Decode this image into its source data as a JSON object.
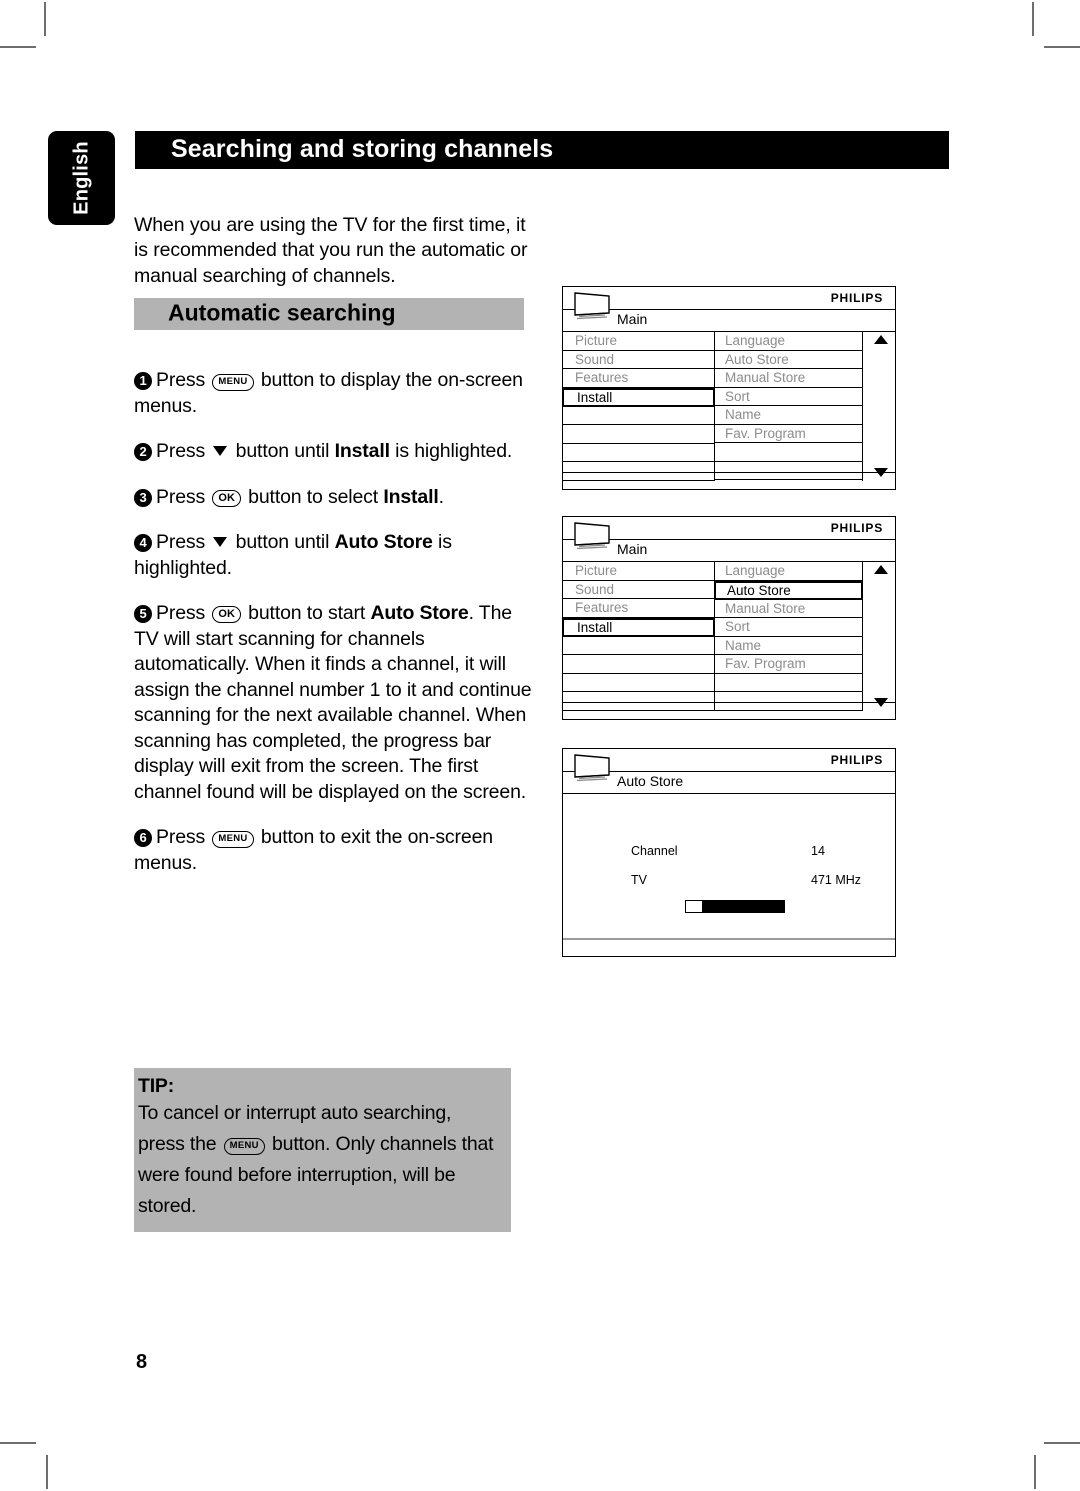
{
  "page": {
    "language_tab": "English",
    "title": "Searching and storing channels",
    "number": "8"
  },
  "intro": "When you are using the TV for the first time, it is recommended that you run the automatic or manual searching of channels.",
  "section": {
    "heading": "Automatic searching"
  },
  "steps": [
    {
      "num": "1",
      "pre": "Press",
      "key": "MENU",
      "post": "button to display the on-screen menus."
    },
    {
      "num": "2",
      "pre": "Press",
      "key": "down-arrow",
      "post_a": "button until",
      "bold": "Install",
      "post_b": "is highlighted."
    },
    {
      "num": "3",
      "pre": "Press",
      "key": "OK",
      "post_a": "button to select",
      "bold": "Install",
      "post_b": "."
    },
    {
      "num": "4",
      "pre": "Press",
      "key": "down-arrow",
      "post_a": "button until",
      "bold": "Auto Store",
      "post_b": "is highlighted."
    },
    {
      "num": "5",
      "pre": "Press",
      "key": "OK",
      "post_a": "button to start",
      "bold": "Auto Store",
      "post_b": ". The TV will start scanning for channels automatically. When it finds a channel, it will assign the channel number 1 to it and continue scanning for the next available channel. When scanning has completed, the progress bar display will exit from the screen. The first channel found will be displayed on the screen."
    },
    {
      "num": "6",
      "pre": "Press",
      "key": "MENU",
      "post": "button to exit the on-screen menus."
    }
  ],
  "tip": {
    "label": "TIP:",
    "text_a": "To cancel or interrupt auto searching, press the",
    "key": "MENU",
    "text_b": "button. Only channels that were found before interruption, will be stored."
  },
  "osd": {
    "brand": "PHILIPS",
    "screens": [
      {
        "title": "Main",
        "left_items": [
          "Picture",
          "Sound",
          "Features",
          "Install",
          "",
          "",
          "",
          ""
        ],
        "left_selected": 3,
        "right_items": [
          "Language",
          "Auto Store",
          "Manual Store",
          "Sort",
          "Name",
          "Fav. Program",
          "",
          ""
        ],
        "right_selected": -1
      },
      {
        "title": "Main",
        "left_items": [
          "Picture",
          "Sound",
          "Features",
          "Install",
          "",
          "",
          "",
          ""
        ],
        "left_selected": 3,
        "right_items": [
          "Language",
          "Auto Store",
          "Manual Store",
          "Sort",
          "Name",
          "Fav. Program",
          "",
          ""
        ],
        "right_selected": 1
      }
    ],
    "auto_store": {
      "title": "Auto Store",
      "channel_label": "Channel",
      "channel_value": "14",
      "source_label": "TV",
      "frequency_value": "471 MHz",
      "progress_percent": 83
    }
  },
  "colors": {
    "band_gray": "#b3b3b3",
    "title_black": "#000000",
    "menu_dim": "#8c8c8c"
  }
}
